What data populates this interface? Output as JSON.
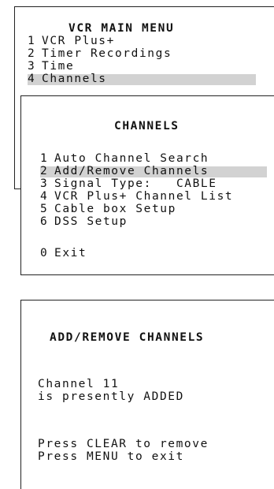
{
  "main_menu": {
    "title": "VCR MAIN MENU",
    "items": [
      {
        "num": "1",
        "label": "VCR Plus+"
      },
      {
        "num": "2",
        "label": "Timer Recordings"
      },
      {
        "num": "3",
        "label": "Time"
      },
      {
        "num": "4",
        "label": "Channels"
      }
    ],
    "selected_index": 3
  },
  "channels_menu": {
    "title": "CHANNELS",
    "items": [
      {
        "num": "1",
        "label": "Auto Channel Search"
      },
      {
        "num": "2",
        "label": "Add/Remove Channels"
      },
      {
        "num": "3",
        "label": "Signal Type:   CABLE"
      },
      {
        "num": "4",
        "label": "VCR Plus+ Channel List"
      },
      {
        "num": "5",
        "label": "Cable box Setup"
      },
      {
        "num": "6",
        "label": "DSS Setup"
      }
    ],
    "exit": {
      "num": "0",
      "label": "Exit"
    },
    "selected_index": 1
  },
  "add_remove_screen": {
    "title": "ADD/REMOVE CHANNELS",
    "status_line1": "Channel 11",
    "status_line2": "is presently ADDED",
    "instruction1": "Press CLEAR to remove",
    "instruction2": "Press MENU to exit"
  },
  "colors": {
    "highlight": "#d2d2d2",
    "border": "#222222",
    "text": "#111111"
  }
}
